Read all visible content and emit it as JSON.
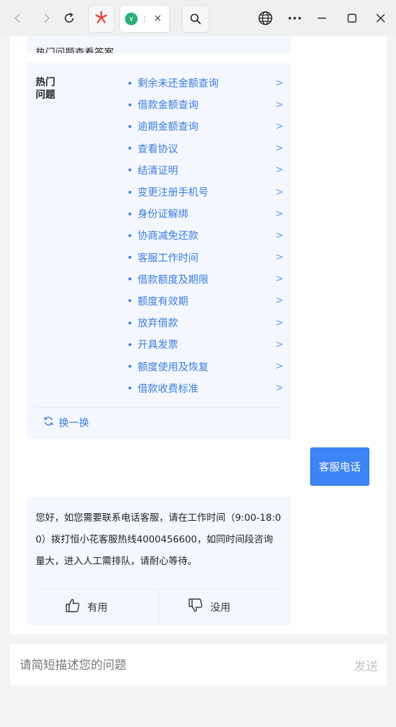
{
  "browser": {
    "tab_initial": "v",
    "tab_ellipsis": "⋮",
    "icons": [
      "back-icon",
      "forward-icon",
      "reload-icon",
      "app-logo-icon",
      "search-icon",
      "globe-icon",
      "more-icon",
      "minimize-icon",
      "maximize-icon",
      "close-window-icon"
    ]
  },
  "top_card": {
    "text": "热门问题查看答案。"
  },
  "hot": {
    "label": "热门问题",
    "items": [
      "剩余未还金额查询",
      "借款金额查询",
      "逾期金额查询",
      "查看协议",
      "结清证明",
      "变更注册手机号",
      "身份证解绑",
      "协商减免还款",
      "客服工作时间",
      "借款额度及期限",
      "额度有效期",
      "放弃借款",
      "开具发票",
      "额度使用及恢复",
      "借款收费标准"
    ],
    "arrow": ">",
    "refresh_label": "换一换"
  },
  "user_message": "客服电话",
  "reply": {
    "text": "您好，如您需要联系电话客服，请在工作时间（9:00-18:00）拨打恒小花客服热线4000456600，如同时间段咨询量大，进入人工需排队，请耐心等待。",
    "useful_label": "有用",
    "useless_label": "没用"
  },
  "composer": {
    "placeholder": "请简短描述您的问题",
    "send_label": "发送"
  },
  "colors": {
    "accent": "#3d84f7",
    "link": "#3c7ce0",
    "card_bg": "#f4f8fe"
  }
}
